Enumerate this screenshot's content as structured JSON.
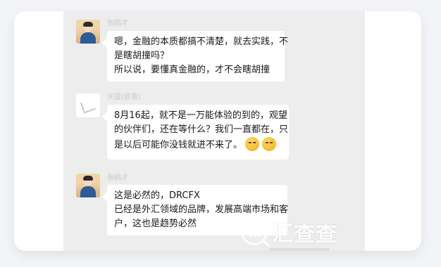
{
  "messages": [
    {
      "sender_name": "张鸥才",
      "avatar_icon": "user-photo-avatar",
      "lines": [
        "嗯，金融的本质都搞不清楚，就去实践，不",
        "是瞎胡撞吗？",
        "所以说，要懂真金融的，才不会瞎胡撞"
      ]
    },
    {
      "sender_name": "天蓝(欢喜)",
      "avatar_icon": "sketch-avatar",
      "lines": [
        "8月16起，就不是一万能体验的到的，观望",
        "的伙伴们，还在等什么？我们一直都在，只",
        "是以后可能你没钱就进不来了。"
      ],
      "trailing_emojis": [
        "thinking-emoji",
        "thinking-emoji"
      ]
    },
    {
      "sender_name": "张鸥才",
      "avatar_icon": "user-photo-avatar",
      "lines": [
        "这是必然的，DRCFX",
        "已经是外汇领域的品牌，发展高端市场和客",
        "户，这也是趋势必然"
      ]
    }
  ],
  "watermark": {
    "text": "汇查查",
    "icon": "chart-search-logo-icon",
    "color": "#ffffff"
  },
  "colors": {
    "page_background": "#f3f4f7",
    "chat_background": "#ededed",
    "bubble_background": "#ffffff",
    "message_text": "#191919",
    "sender_name": "#c8c8c8"
  }
}
